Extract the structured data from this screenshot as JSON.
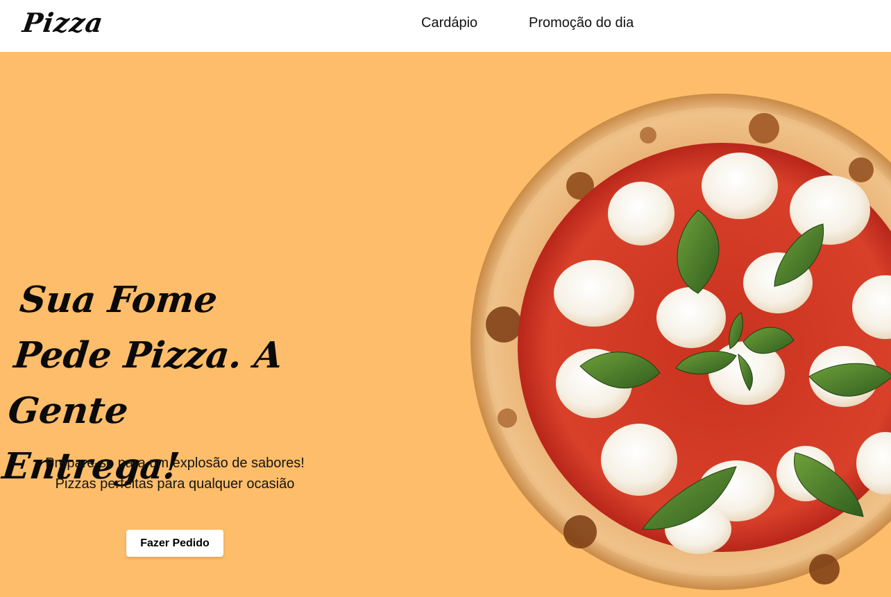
{
  "header": {
    "logo": "Pizza",
    "nav": [
      {
        "label": "Cardápio"
      },
      {
        "label": "Promoção do dia"
      }
    ]
  },
  "hero": {
    "headline": "Sua Fome Pede Pizza. A Gente Entrega!",
    "subtitle": "Prepare-se para um explosão de sabores! Pizzas perfeitas para qualquer ocasião",
    "cta_label": "Fazer Pedido",
    "image": "margherita-pizza-image"
  },
  "colors": {
    "hero_background": "#fdbd6a",
    "header_background": "#ffffff",
    "text": "#0a0a0a",
    "button_background": "#ffffff"
  }
}
